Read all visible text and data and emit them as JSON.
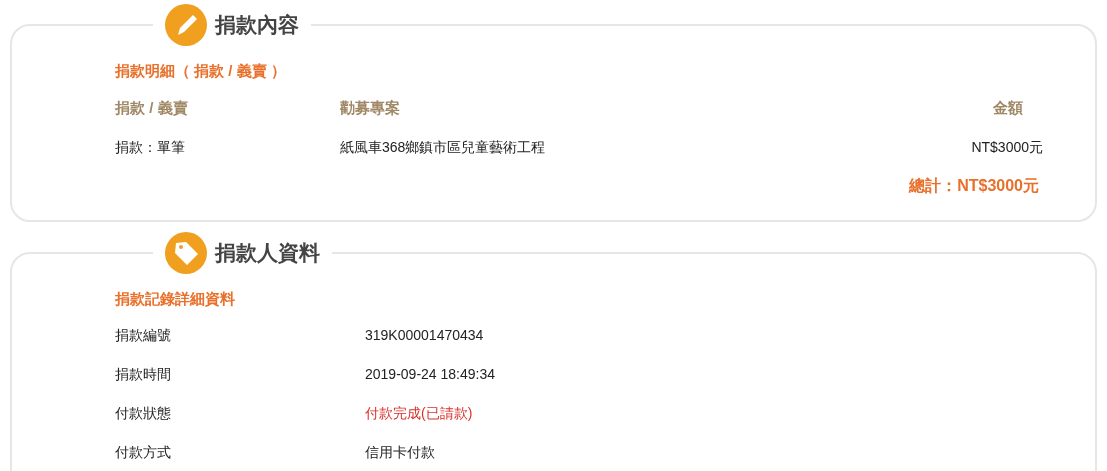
{
  "sections": [
    {
      "title": "捐款內容",
      "kind": "pencil",
      "subtitle": "捐款明細（ 捐款 / 義賣 ）",
      "columns": [
        "捐款 / 義賣",
        "勸募專案",
        "金額"
      ],
      "rows": [
        [
          "捐款：單筆",
          "紙風車368鄉鎮市區兒童藝術工程",
          "NT$3000元"
        ]
      ],
      "total": "總計：NT$3000元"
    },
    {
      "title": "捐款人資料",
      "kind": "tag",
      "subtitle": "捐款記錄詳細資料",
      "fields": [
        {
          "label": "捐款編號",
          "value": "319K00001470434",
          "kind": "plain"
        },
        {
          "label": "捐款時間",
          "value": "2019-09-24 18:49:34",
          "kind": "plain"
        },
        {
          "label": "付款狀態",
          "value": "付款完成(已請款)",
          "kind": "status"
        },
        {
          "label": "付款方式",
          "value": "信用卡付款",
          "kind": "plain"
        }
      ]
    }
  ]
}
